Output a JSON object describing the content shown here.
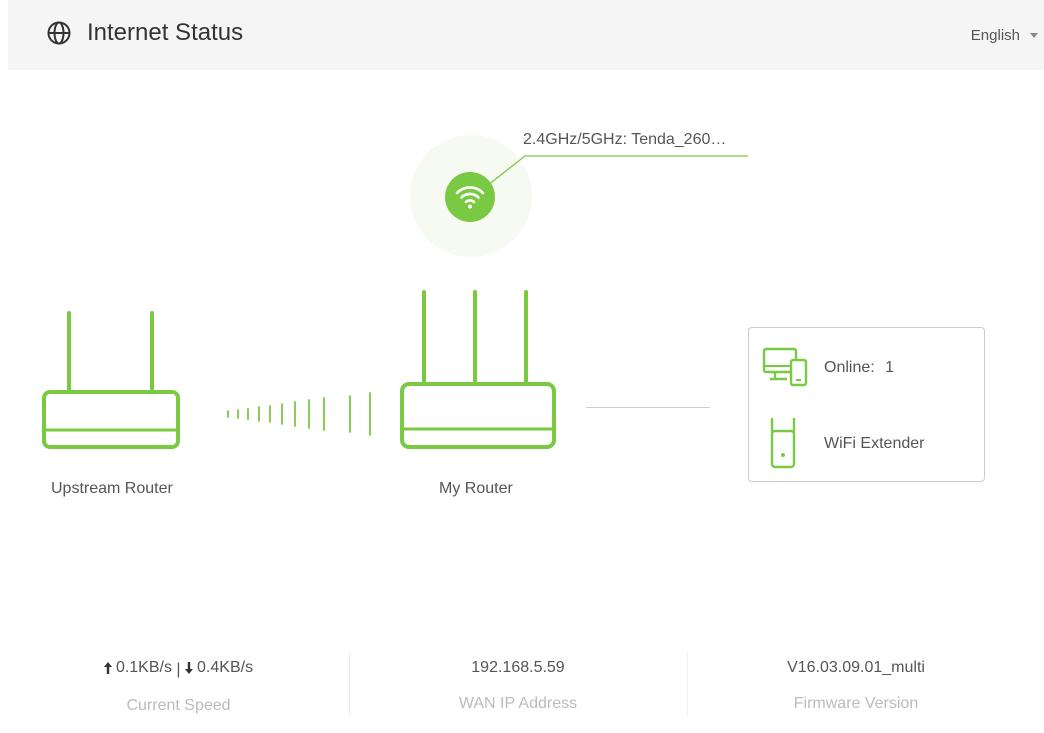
{
  "header": {
    "title": "Internet Status",
    "language": "English",
    "globe_icon": "globe-icon"
  },
  "colors": {
    "accent": "#7ac943",
    "header_bg": "#f5f5f5"
  },
  "wifi": {
    "ssid": "2.4GHz/5GHz: Tenda_260…",
    "icon": "wifi-icon"
  },
  "topology": {
    "upstream_label": "Upstream Router",
    "router_label": "My Router"
  },
  "clients": {
    "online_label": "Online:",
    "online_count": "1",
    "extender_label": "WiFi Extender"
  },
  "stats": {
    "upload": "0.1KB/s",
    "download": "0.4KB/s",
    "speed_caption": "Current Speed",
    "wan_ip": "192.168.5.59",
    "wan_caption": "WAN IP Address",
    "firmware": "V16.03.09.01_multi",
    "firmware_caption": "Firmware Version"
  }
}
